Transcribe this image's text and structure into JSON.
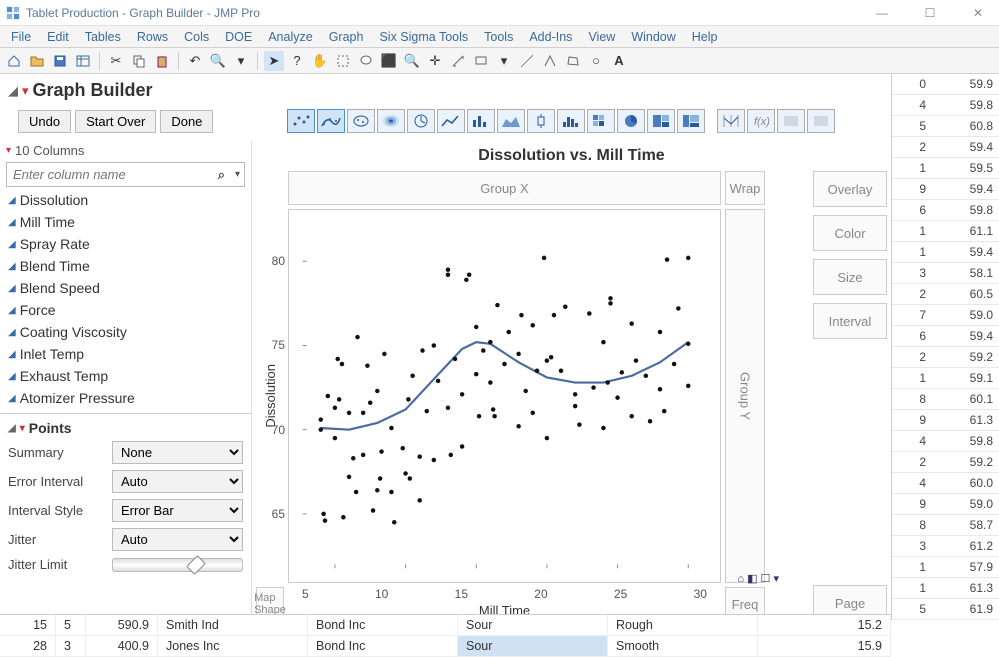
{
  "window": {
    "title": "Tablet Production - Graph Builder - JMP Pro",
    "min": "—",
    "max": "☐",
    "close": "✕"
  },
  "menubar": [
    "File",
    "Edit",
    "Tables",
    "Rows",
    "Cols",
    "DOE",
    "Analyze",
    "Graph",
    "Six Sigma Tools",
    "Tools",
    "Add-Ins",
    "View",
    "Window",
    "Help"
  ],
  "gbuilder": {
    "title": "Graph Builder",
    "undo": "Undo",
    "startover": "Start Over",
    "done": "Done",
    "cols_label": "10 Columns",
    "search_placeholder": "Enter column name",
    "columns": [
      "Dissolution",
      "Mill Time",
      "Spray Rate",
      "Blend Time",
      "Blend Speed",
      "Force",
      "Coating Viscosity",
      "Inlet Temp",
      "Exhaust Temp",
      "Atomizer Pressure"
    ],
    "points": {
      "header": "Points",
      "summary_label": "Summary",
      "summary": "None",
      "err_label": "Error Interval",
      "err": "Auto",
      "intstyle_label": "Interval Style",
      "intstyle": "Error Bar",
      "jitter_label": "Jitter",
      "jitter": "Auto",
      "jitlimit_label": "Jitter Limit"
    }
  },
  "chart_data": {
    "type": "scatter",
    "title": "Dissolution vs. Mill Time",
    "xlabel": "Mill Time",
    "ylabel": "Dissolution",
    "xlim": [
      3,
      31
    ],
    "ylim": [
      62,
      82
    ],
    "xticks": [
      5,
      10,
      15,
      20,
      25,
      30
    ],
    "yticks": [
      65,
      70,
      75,
      80
    ],
    "smoother": [
      {
        "x": 4,
        "y": 70.1
      },
      {
        "x": 6,
        "y": 70.0
      },
      {
        "x": 8,
        "y": 70.4
      },
      {
        "x": 10,
        "y": 71.2
      },
      {
        "x": 12,
        "y": 73.0
      },
      {
        "x": 14,
        "y": 74.8
      },
      {
        "x": 15,
        "y": 75.2
      },
      {
        "x": 16,
        "y": 75.1
      },
      {
        "x": 18,
        "y": 74.0
      },
      {
        "x": 20,
        "y": 73.1
      },
      {
        "x": 22,
        "y": 72.8
      },
      {
        "x": 24,
        "y": 72.8
      },
      {
        "x": 26,
        "y": 73.2
      },
      {
        "x": 28,
        "y": 74.0
      },
      {
        "x": 30,
        "y": 75.2
      }
    ],
    "points": [
      {
        "x": 4,
        "y": 70
      },
      {
        "x": 4,
        "y": 70.6
      },
      {
        "x": 4.2,
        "y": 65
      },
      {
        "x": 4.3,
        "y": 64.6
      },
      {
        "x": 4.5,
        "y": 72
      },
      {
        "x": 5,
        "y": 71.3
      },
      {
        "x": 5,
        "y": 69.5
      },
      {
        "x": 5.2,
        "y": 74.2
      },
      {
        "x": 5.3,
        "y": 71.8
      },
      {
        "x": 5.5,
        "y": 73.9
      },
      {
        "x": 5.6,
        "y": 64.8
      },
      {
        "x": 6,
        "y": 71
      },
      {
        "x": 6,
        "y": 67.2
      },
      {
        "x": 6.3,
        "y": 68.3
      },
      {
        "x": 6.5,
        "y": 66.3
      },
      {
        "x": 6.6,
        "y": 75.5
      },
      {
        "x": 7,
        "y": 71
      },
      {
        "x": 7,
        "y": 68.5
      },
      {
        "x": 7.3,
        "y": 73.8
      },
      {
        "x": 7.5,
        "y": 71.6
      },
      {
        "x": 7.7,
        "y": 65.2
      },
      {
        "x": 8,
        "y": 66.4
      },
      {
        "x": 8,
        "y": 72.3
      },
      {
        "x": 8.2,
        "y": 67.1
      },
      {
        "x": 8.3,
        "y": 68.7
      },
      {
        "x": 8.5,
        "y": 74.5
      },
      {
        "x": 9,
        "y": 66.3
      },
      {
        "x": 9,
        "y": 70.1
      },
      {
        "x": 9.2,
        "y": 64.5
      },
      {
        "x": 9.8,
        "y": 68.9
      },
      {
        "x": 10,
        "y": 67.4
      },
      {
        "x": 10.2,
        "y": 71.8
      },
      {
        "x": 10.3,
        "y": 67.1
      },
      {
        "x": 10.5,
        "y": 73.2
      },
      {
        "x": 11,
        "y": 65.8
      },
      {
        "x": 11,
        "y": 68.4
      },
      {
        "x": 11.2,
        "y": 74.7
      },
      {
        "x": 11.5,
        "y": 71.1
      },
      {
        "x": 12,
        "y": 75
      },
      {
        "x": 12,
        "y": 68.2
      },
      {
        "x": 12.3,
        "y": 72.9
      },
      {
        "x": 13,
        "y": 71.3
      },
      {
        "x": 13,
        "y": 79.2
      },
      {
        "x": 13,
        "y": 79.5
      },
      {
        "x": 13.2,
        "y": 68.5
      },
      {
        "x": 13.5,
        "y": 74.2
      },
      {
        "x": 14,
        "y": 69
      },
      {
        "x": 14,
        "y": 72.1
      },
      {
        "x": 14.3,
        "y": 78.9
      },
      {
        "x": 14.5,
        "y": 79.2
      },
      {
        "x": 15,
        "y": 73.3
      },
      {
        "x": 15,
        "y": 76.1
      },
      {
        "x": 15.2,
        "y": 70.8
      },
      {
        "x": 15.5,
        "y": 74.7
      },
      {
        "x": 16,
        "y": 75.2
      },
      {
        "x": 16,
        "y": 72.8
      },
      {
        "x": 16.2,
        "y": 71.2
      },
      {
        "x": 16.3,
        "y": 70.8
      },
      {
        "x": 16.5,
        "y": 77.4
      },
      {
        "x": 17,
        "y": 73.9
      },
      {
        "x": 17.3,
        "y": 75.8
      },
      {
        "x": 18,
        "y": 70.2
      },
      {
        "x": 18,
        "y": 74.5
      },
      {
        "x": 18.2,
        "y": 76.8
      },
      {
        "x": 18.5,
        "y": 72.3
      },
      {
        "x": 19,
        "y": 71
      },
      {
        "x": 19,
        "y": 76.2
      },
      {
        "x": 19.3,
        "y": 73.5
      },
      {
        "x": 19.8,
        "y": 80.2
      },
      {
        "x": 20,
        "y": 69.5
      },
      {
        "x": 20,
        "y": 74.1
      },
      {
        "x": 20.3,
        "y": 74.3
      },
      {
        "x": 20.5,
        "y": 76.8
      },
      {
        "x": 21,
        "y": 73.5
      },
      {
        "x": 21.3,
        "y": 77.3
      },
      {
        "x": 22,
        "y": 72.1
      },
      {
        "x": 22,
        "y": 71.4
      },
      {
        "x": 22.3,
        "y": 70.3
      },
      {
        "x": 23,
        "y": 76.9
      },
      {
        "x": 23.3,
        "y": 72.5
      },
      {
        "x": 24,
        "y": 70.1
      },
      {
        "x": 24,
        "y": 75.2
      },
      {
        "x": 24.3,
        "y": 72.8
      },
      {
        "x": 24.5,
        "y": 77.5
      },
      {
        "x": 24.5,
        "y": 77.8
      },
      {
        "x": 25,
        "y": 71.9
      },
      {
        "x": 25.3,
        "y": 73.4
      },
      {
        "x": 26,
        "y": 70.8
      },
      {
        "x": 26,
        "y": 76.3
      },
      {
        "x": 26.3,
        "y": 74.1
      },
      {
        "x": 27,
        "y": 73.2
      },
      {
        "x": 27.3,
        "y": 70.5
      },
      {
        "x": 28,
        "y": 75.8
      },
      {
        "x": 28,
        "y": 72.4
      },
      {
        "x": 28.3,
        "y": 71.1
      },
      {
        "x": 28.5,
        "y": 80.1
      },
      {
        "x": 29,
        "y": 73.9
      },
      {
        "x": 29.3,
        "y": 77.2
      },
      {
        "x": 30,
        "y": 72.6
      },
      {
        "x": 30,
        "y": 75.1
      },
      {
        "x": 30,
        "y": 80.2
      }
    ]
  },
  "dropzones": {
    "groupx": "Group X",
    "groupy": "Group Y",
    "wrap": "Wrap",
    "overlay": "Overlay",
    "color": "Color",
    "size": "Size",
    "interval": "Interval",
    "freq": "Freq",
    "page": "Page",
    "mapshape": "Map\nShape"
  },
  "right_cells": [
    [
      "0",
      "59.9"
    ],
    [
      "4",
      "59.8"
    ],
    [
      "5",
      "60.8"
    ],
    [
      "2",
      "59.4"
    ],
    [
      "1",
      "59.5"
    ],
    [
      "9",
      "59.4"
    ],
    [
      "6",
      "59.8"
    ],
    [
      "1",
      "61.1"
    ],
    [
      "1",
      "59.4"
    ],
    [
      "3",
      "58.1"
    ],
    [
      "2",
      "60.5"
    ],
    [
      "7",
      "59.0"
    ],
    [
      "6",
      "59.4"
    ],
    [
      "2",
      "59.2"
    ],
    [
      "1",
      "59.1"
    ],
    [
      "8",
      "60.1"
    ],
    [
      "9",
      "61.3"
    ],
    [
      "4",
      "59.8"
    ],
    [
      "2",
      "59.2"
    ],
    [
      "4",
      "60.0"
    ],
    [
      "9",
      "59.0"
    ],
    [
      "8",
      "58.7"
    ],
    [
      "3",
      "61.2"
    ],
    [
      "1",
      "57.9"
    ],
    [
      "1",
      "61.3"
    ],
    [
      "5",
      "61.9"
    ]
  ],
  "bottom_rows": [
    {
      "a": "15",
      "b": "5",
      "c": "590.9",
      "d": "Smith Ind",
      "e": "Bond Inc",
      "f": "Sour",
      "g": "Rough",
      "h": "15.2"
    },
    {
      "a": "28",
      "b": "3",
      "c": "400.9",
      "d": "Jones Inc",
      "e": "Bond Inc",
      "f": "Sour",
      "g": "Smooth",
      "h": "15.9"
    }
  ]
}
